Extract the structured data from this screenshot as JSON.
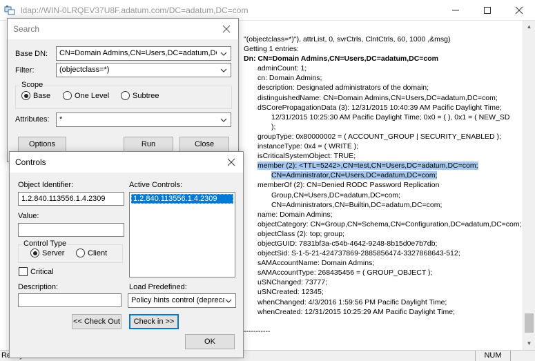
{
  "main": {
    "title": "ldap://WIN-0LRQEV37U8F.adatum.com/DC=adatum,DC=com",
    "status_ready": "Ready",
    "status_num": "NUM",
    "output": {
      "lines": [
        {
          "text": "\"(objectclass=*)\"), attrList,  0, svrCtrls, ClntCtrls, 60, 1000 ,&msg)",
          "indent": 0,
          "bold": false,
          "highlight": false
        },
        {
          "text": "Getting 1 entries:",
          "indent": 0,
          "bold": false,
          "highlight": false
        },
        {
          "text": "Dn: CN=Domain Admins,CN=Users,DC=adatum,DC=com",
          "indent": 0,
          "bold": true,
          "highlight": false
        },
        {
          "text": "adminCount: 1;",
          "indent": 1,
          "bold": false,
          "highlight": false
        },
        {
          "text": "cn: Domain Admins;",
          "indent": 1,
          "bold": false,
          "highlight": false
        },
        {
          "text": "description: Designated administrators of the domain;",
          "indent": 1,
          "bold": false,
          "highlight": false
        },
        {
          "text": "distinguishedName: CN=Domain Admins,CN=Users,DC=adatum,DC=com;",
          "indent": 1,
          "bold": false,
          "highlight": false
        },
        {
          "text": "dSCorePropagationData (3): 12/31/2015 10:40:39 AM Pacific Daylight Time;",
          "indent": 1,
          "bold": false,
          "highlight": false
        },
        {
          "text": "12/31/2015 10:25:30 AM Pacific Daylight Time; 0x0 = (  ), 0x1 = ( NEW_SD",
          "indent": 2,
          "bold": false,
          "highlight": false
        },
        {
          "text": ");",
          "indent": 2,
          "bold": false,
          "highlight": false
        },
        {
          "text": "groupType: 0x80000002 = ( ACCOUNT_GROUP | SECURITY_ENABLED );",
          "indent": 1,
          "bold": false,
          "highlight": false
        },
        {
          "text": "instanceType: 0x4 = ( WRITE );",
          "indent": 1,
          "bold": false,
          "highlight": false
        },
        {
          "text": "isCriticalSystemObject: TRUE;",
          "indent": 1,
          "bold": false,
          "highlight": false
        },
        {
          "text": "member (2): <TTL=5242>,CN=test,CN=Users,DC=adatum,DC=com;",
          "indent": 1,
          "bold": false,
          "highlight": true
        },
        {
          "text": "CN=Administrator,CN=Users,DC=adatum,DC=com;",
          "indent": 2,
          "bold": false,
          "highlight": true
        },
        {
          "text": "memberOf (2): CN=Denied RODC Password Replication",
          "indent": 1,
          "bold": false,
          "highlight": false
        },
        {
          "text": "Group,CN=Users,DC=adatum,DC=com;",
          "indent": 2,
          "bold": false,
          "highlight": false
        },
        {
          "text": "CN=Administrators,CN=Builtin,DC=adatum,DC=com;",
          "indent": 2,
          "bold": false,
          "highlight": false
        },
        {
          "text": "name: Domain Admins;",
          "indent": 1,
          "bold": false,
          "highlight": false
        },
        {
          "text": "objectCategory: CN=Group,CN=Schema,CN=Configuration,DC=adatum,DC=com;",
          "indent": 1,
          "bold": false,
          "highlight": false
        },
        {
          "text": "objectClass (2): top; group;",
          "indent": 1,
          "bold": false,
          "highlight": false
        },
        {
          "text": "objectGUID: 7831bf3a-c54b-4642-9248-8b15d0e7b7db;",
          "indent": 1,
          "bold": false,
          "highlight": false
        },
        {
          "text": "objectSid: S-1-5-21-424737869-2885856474-3327868643-512;",
          "indent": 1,
          "bold": false,
          "highlight": false
        },
        {
          "text": "sAMAccountName: Domain Admins;",
          "indent": 1,
          "bold": false,
          "highlight": false
        },
        {
          "text": "sAMAccountType: 268435456 = ( GROUP_OBJECT );",
          "indent": 1,
          "bold": false,
          "highlight": false
        },
        {
          "text": "uSNChanged: 73777;",
          "indent": 1,
          "bold": false,
          "highlight": false
        },
        {
          "text": "uSNCreated: 12345;",
          "indent": 1,
          "bold": false,
          "highlight": false
        },
        {
          "text": "whenChanged: 4/3/2016 1:59:56 PM Pacific Daylight Time;",
          "indent": 1,
          "bold": false,
          "highlight": false
        },
        {
          "text": "whenCreated: 12/31/2015 10:25:29 AM Pacific Daylight Time;",
          "indent": 1,
          "bold": false,
          "highlight": false
        },
        {
          "text": "",
          "indent": 0,
          "bold": false,
          "highlight": false
        },
        {
          "text": "-----------",
          "indent": 0,
          "bold": false,
          "highlight": false
        }
      ]
    }
  },
  "search": {
    "title": "Search",
    "base_dn_label": "Base DN:",
    "base_dn_value": "CN=Domain Admins,CN=Users,DC=adatum,DC",
    "filter_label": "Filter:",
    "filter_value": "(objectclass=*)",
    "scope_label": "Scope",
    "scope_options": [
      "Base",
      "One Level",
      "Subtree"
    ],
    "scope_selected": "Base",
    "attributes_label": "Attributes:",
    "attributes_value": "*",
    "options_button": "Options",
    "run_button": "Run",
    "close_button": "Close"
  },
  "controls": {
    "title": "Controls",
    "object_identifier_label": "Object Identifier:",
    "object_identifier_value": "1.2.840.113556.1.4.2309",
    "value_label": "Value:",
    "value_value": "",
    "control_type_label": "Control Type",
    "control_type_options": [
      "Server",
      "Client"
    ],
    "control_type_selected": "Server",
    "critical_label": "Critical",
    "critical_checked": false,
    "description_label": "Description:",
    "description_value": "",
    "active_controls_label": "Active Controls:",
    "active_controls": [
      "1.2.840.113556.1.4.2309"
    ],
    "load_predefined_label": "Load Predefined:",
    "load_predefined_value": "Policy hints control (depreca",
    "check_out_button": "<< Check Out",
    "check_in_button": "Check in >>",
    "ok_button": "OK"
  }
}
